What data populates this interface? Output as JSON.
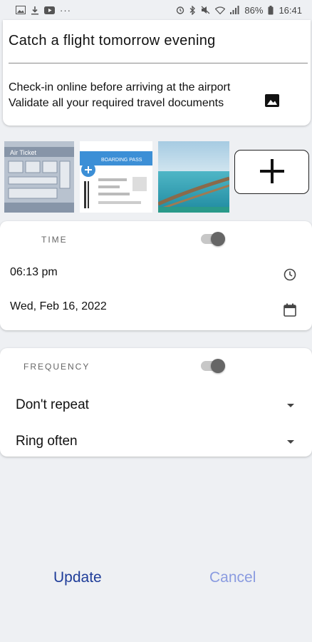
{
  "status_bar": {
    "battery": "86%",
    "time": "16:41",
    "overflow": "···"
  },
  "note": {
    "title": "Catch a flight tomorrow evening",
    "line1": "Check-in online before arriving at the airport",
    "line2": "Validate all your required travel documents"
  },
  "thumbnails": {
    "ticket_caption": "Air Ticket",
    "boarding_caption": "BOARDING PASS"
  },
  "time_section": {
    "label": "TIME",
    "time_value": "06:13 pm",
    "date_value": "Wed, Feb 16, 2022"
  },
  "frequency_section": {
    "label": "FREQUENCY",
    "repeat_value": "Don't repeat",
    "ring_value": "Ring often"
  },
  "actions": {
    "update_label": "Update",
    "cancel_label": "Cancel"
  },
  "colors": {
    "update": "#1f3d99",
    "cancel": "#8a9be0"
  }
}
